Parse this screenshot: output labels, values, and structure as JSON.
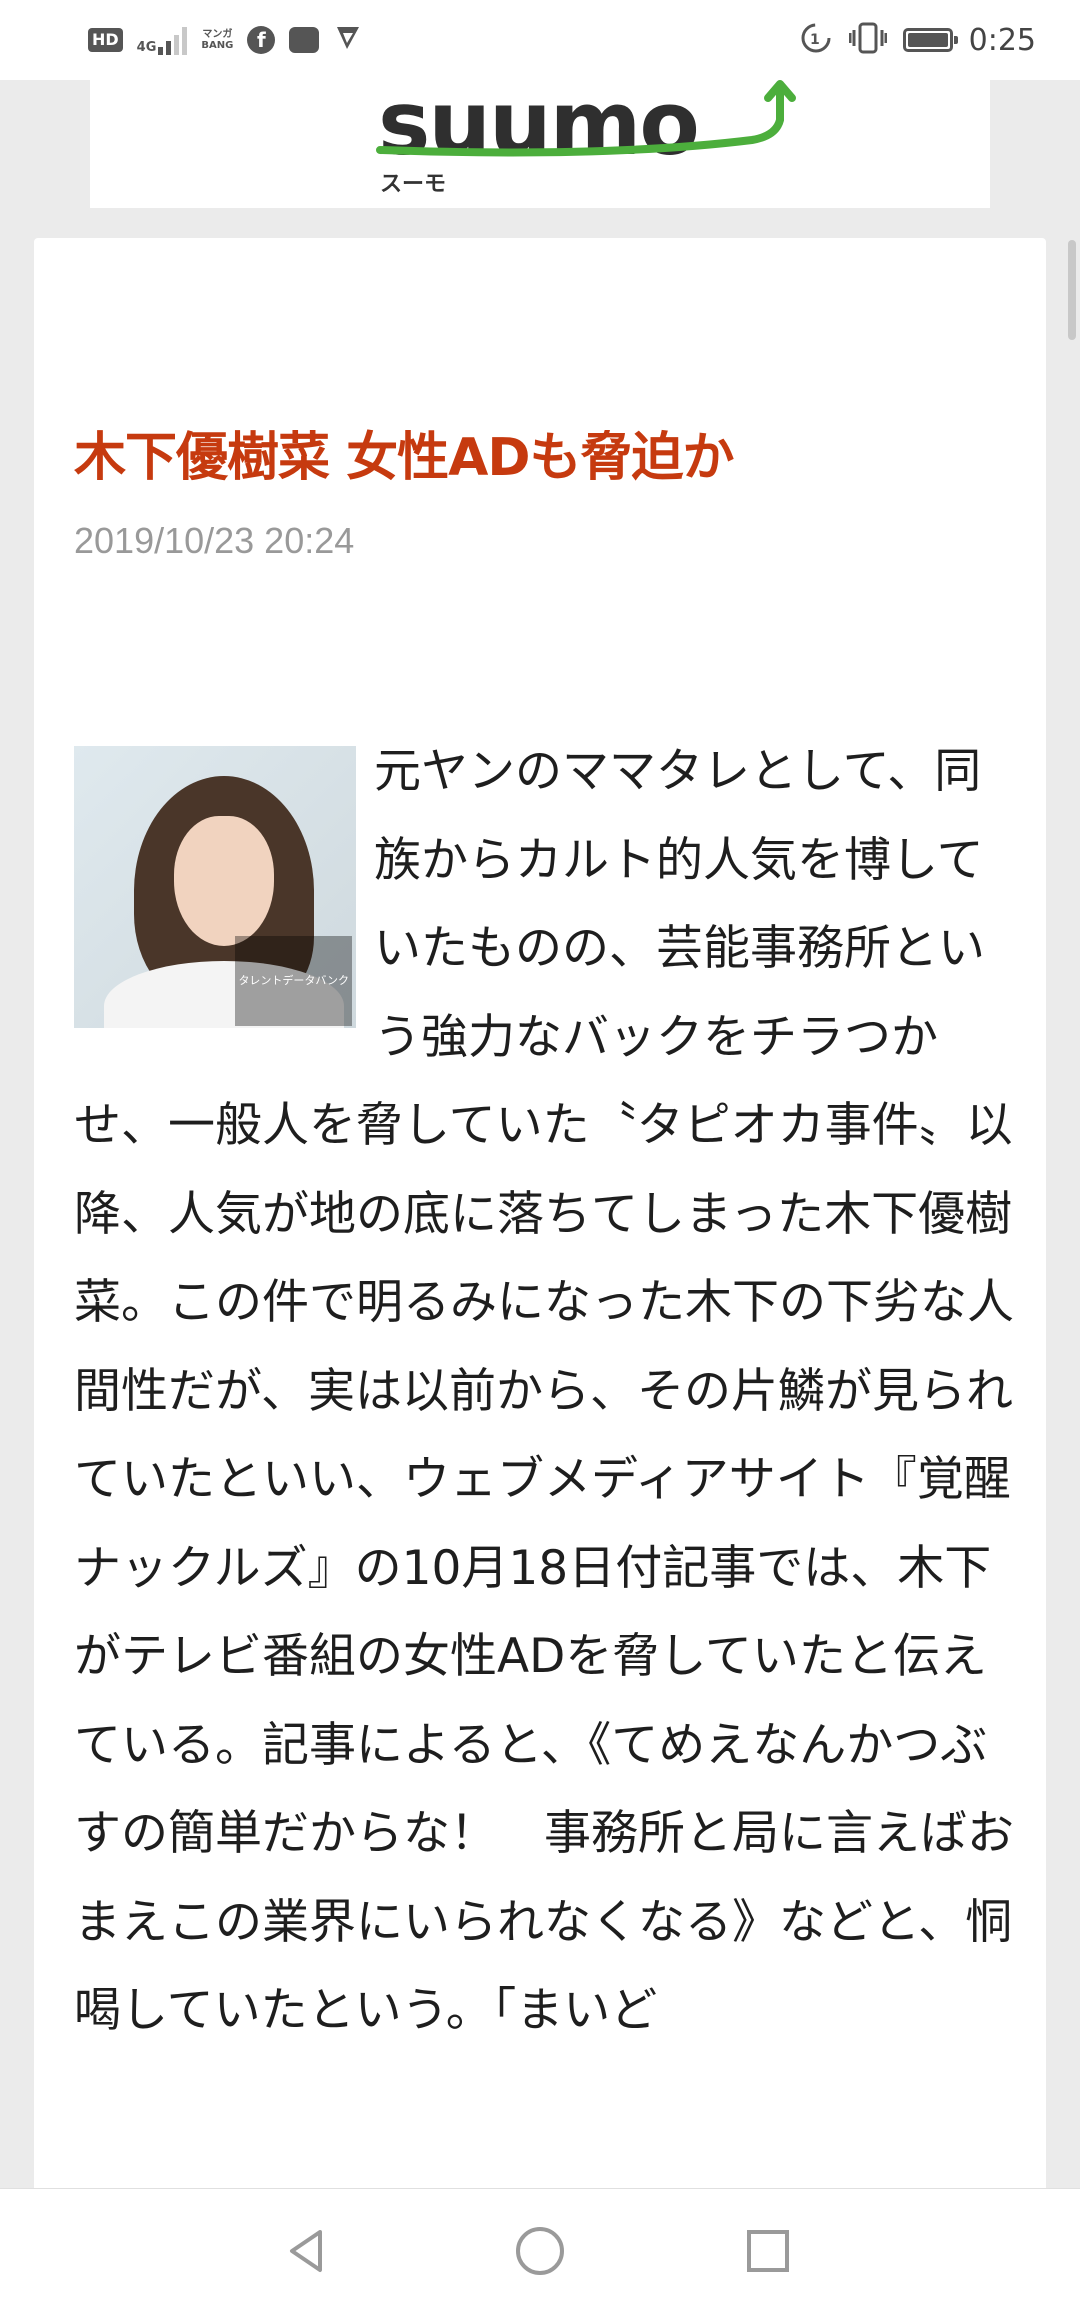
{
  "status_bar": {
    "hd": "HD",
    "network": "4G",
    "manga_label_1": "マンガ",
    "manga_label_2": "BANG",
    "facebook_glyph": "f",
    "time": "0:25",
    "icons": [
      "hd-icon",
      "signal-icon",
      "mangabang-icon",
      "facebook-icon",
      "photo-icon",
      "play-icon",
      "data-saver-icon",
      "vibrate-icon",
      "battery-icon"
    ]
  },
  "ad": {
    "logo_text": "suumo",
    "logo_sub": "スーモ",
    "accent_color": "#4cae3c"
  },
  "article": {
    "headline": "木下優樹菜 女性ADも脅迫か",
    "date": "2019/10/23 20:24",
    "image_caption": "タレントデータバンク",
    "body": "元ヤンのママタレとして、同族からカルト的人気を博していたものの、芸能事務所という強力なバックをチラつかせ、一般人を脅していた〝タピオカ事件〟以降、人気が地の底に落ちてしまった木下優樹菜。この件で明るみになった木下の下劣な人間性だが、実は以前から、その片鱗が見られていたといい、ウェブメディアサイト『覚醒ナックルズ』の10月18日付記事では、木下がテレビ番組の女性ADを脅していたと伝えている。記事によると、《てめえなんかつぶすの簡単だからな！　事務所と局に言えばおまえこの業界にいられなくなる》などと、恫喝していたという。「まいど"
  },
  "colors": {
    "headline": "#c63a0f",
    "date": "#999999",
    "body": "#1e1e1e"
  },
  "nav": {
    "back": "back-icon",
    "home": "home-icon",
    "recents": "recents-icon"
  }
}
